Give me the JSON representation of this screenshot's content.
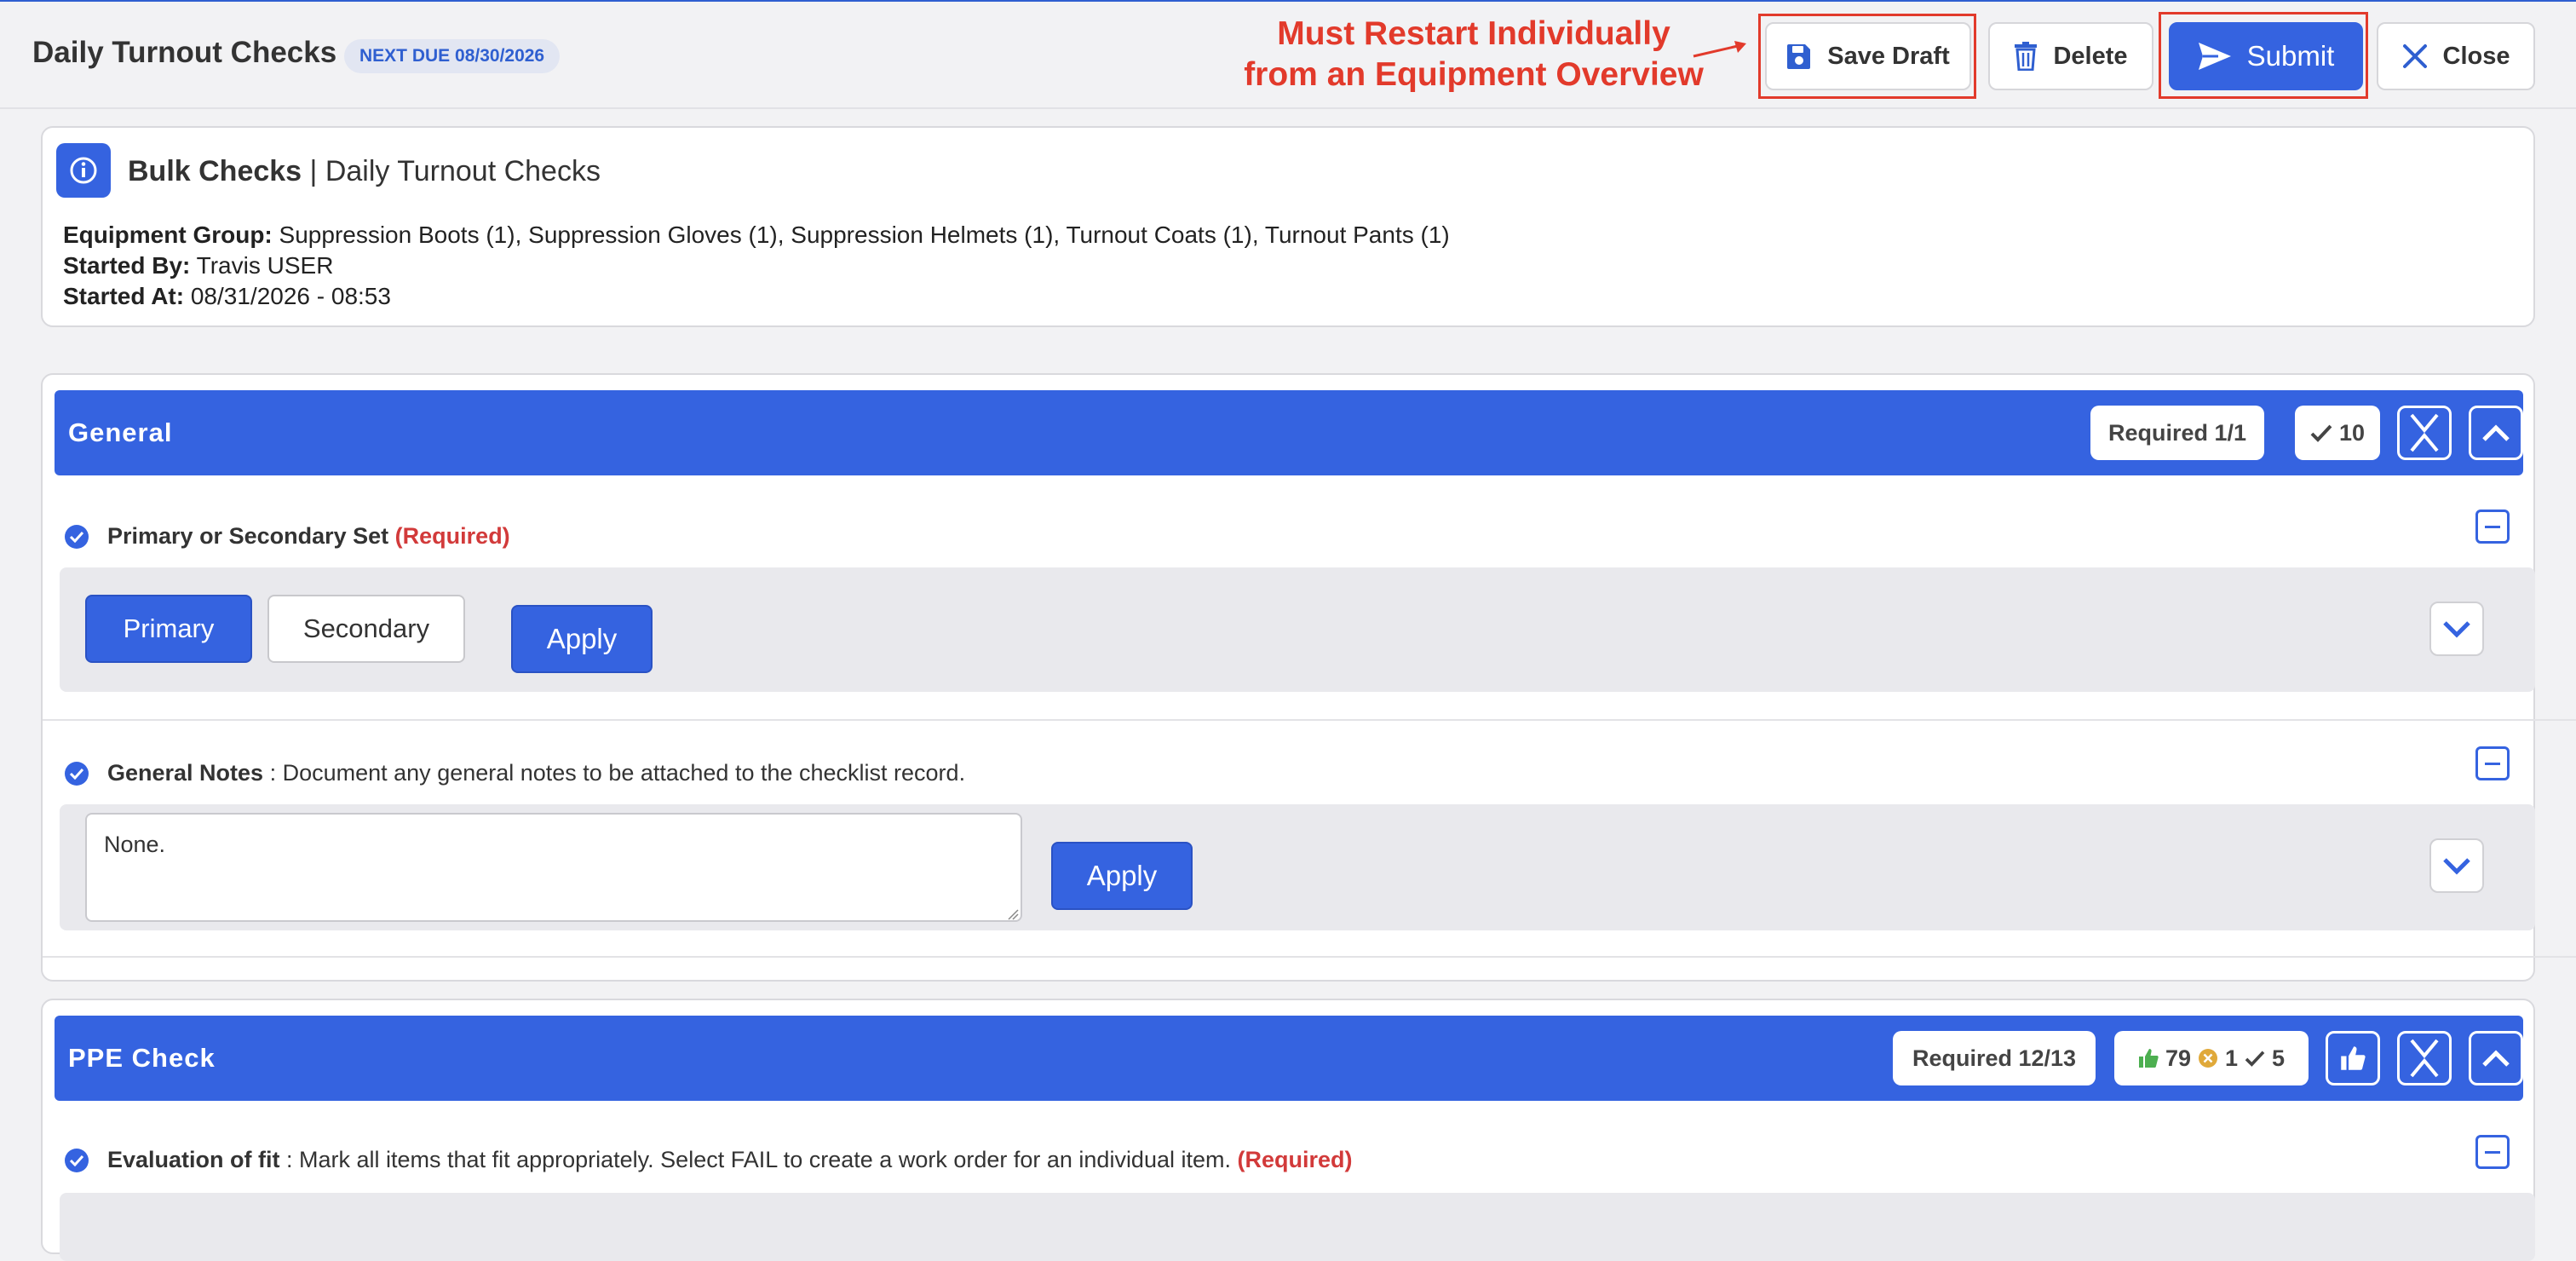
{
  "header": {
    "title": "Daily Turnout Checks",
    "due_badge": "NEXT DUE 08/30/2026",
    "annotation_line1": "Must Restart Individually",
    "annotation_line2": "from an Equipment Overview",
    "save_draft_label": "Save Draft",
    "delete_label": "Delete",
    "submit_label": "Submit",
    "close_label": "Close",
    "annotation_color": "#e23a2b"
  },
  "info_card": {
    "title_bold": "Bulk Checks",
    "title_rest": "| Daily Turnout Checks",
    "equipment_group_label": "Equipment Group:",
    "equipment_group_value": "Suppression Boots (1), Suppression Gloves (1), Suppression Helmets (1), Turnout Coats (1), Turnout Pants (1)",
    "started_by_label": "Started By:",
    "started_by_value": "Travis USER",
    "started_at_label": "Started At:",
    "started_at_value": "08/31/2026 - 08:53"
  },
  "general_section": {
    "title": "General",
    "required_pill": "Required 1/1",
    "check_count": "10",
    "q1": {
      "label": "Primary or Secondary Set",
      "required": "(Required)",
      "options": [
        "Primary",
        "Secondary"
      ],
      "selected": "Primary",
      "apply_label": "Apply"
    },
    "q2": {
      "label": "General Notes",
      "description": ": Document any general notes to be attached to the checklist record.",
      "value": "None.",
      "apply_label": "Apply"
    }
  },
  "ppe_section": {
    "title": "PPE Check",
    "required_pill": "Required 12/13",
    "pass_count": "79",
    "fail_count": "1",
    "check_count": "5",
    "q1": {
      "label": "Evaluation of fit",
      "description": ": Mark all items that fit appropriately. Select FAIL to create a work order for an individual item.",
      "required": "(Required)"
    }
  },
  "colors": {
    "primary": "#3563e0",
    "required_red": "#d23a3a",
    "pass_green": "#4caf50",
    "fail_amber": "#e0a93a"
  }
}
